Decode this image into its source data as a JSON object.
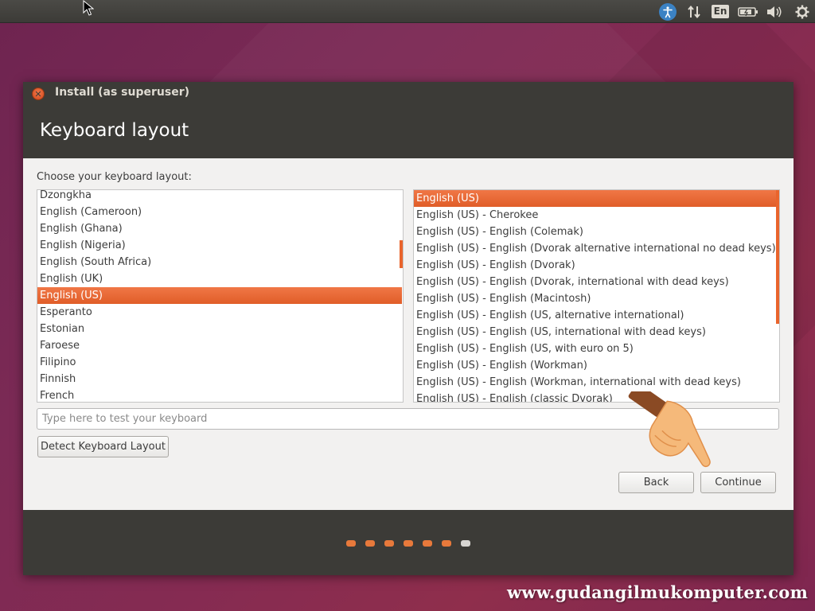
{
  "top_panel": {
    "language_indicator": "En",
    "icons": [
      "accessibility-icon",
      "network-icon",
      "language-indicator",
      "battery-icon",
      "volume-icon",
      "settings-gear-icon"
    ]
  },
  "window": {
    "title": "Install (as superuser)",
    "heading": "Keyboard layout"
  },
  "content": {
    "choose_label": "Choose your keyboard layout:",
    "layouts": [
      {
        "label": "Dzongkha",
        "selected": false
      },
      {
        "label": "English (Cameroon)",
        "selected": false
      },
      {
        "label": "English (Ghana)",
        "selected": false
      },
      {
        "label": "English (Nigeria)",
        "selected": false
      },
      {
        "label": "English (South Africa)",
        "selected": false
      },
      {
        "label": "English (UK)",
        "selected": false
      },
      {
        "label": "English (US)",
        "selected": true
      },
      {
        "label": "Esperanto",
        "selected": false
      },
      {
        "label": "Estonian",
        "selected": false
      },
      {
        "label": "Faroese",
        "selected": false
      },
      {
        "label": "Filipino",
        "selected": false
      },
      {
        "label": "Finnish",
        "selected": false
      },
      {
        "label": "French",
        "selected": false
      }
    ],
    "variants": [
      {
        "label": "English (US)",
        "selected": true
      },
      {
        "label": "English (US) - Cherokee",
        "selected": false
      },
      {
        "label": "English (US) - English (Colemak)",
        "selected": false
      },
      {
        "label": "English (US) - English (Dvorak alternative international no dead keys)",
        "selected": false
      },
      {
        "label": "English (US) - English (Dvorak)",
        "selected": false
      },
      {
        "label": "English (US) - English (Dvorak, international with dead keys)",
        "selected": false
      },
      {
        "label": "English (US) - English (Macintosh)",
        "selected": false
      },
      {
        "label": "English (US) - English (US, alternative international)",
        "selected": false
      },
      {
        "label": "English (US) - English (US, international with dead keys)",
        "selected": false
      },
      {
        "label": "English (US) - English (US, with euro on 5)",
        "selected": false
      },
      {
        "label": "English (US) - English (Workman)",
        "selected": false
      },
      {
        "label": "English (US) - English (Workman, international with dead keys)",
        "selected": false
      },
      {
        "label": "English (US) - English (classic Dvorak)",
        "selected": false
      }
    ],
    "test_input": {
      "value": "",
      "placeholder": "Type here to test your keyboard"
    },
    "detect_button": "Detect Keyboard Layout",
    "back_button": "Back",
    "continue_button": "Continue"
  },
  "progress": {
    "total_steps": 7,
    "current_step": 7
  },
  "watermark": "www.gudangilmukomputer.com",
  "colors": {
    "accent": "#E95420",
    "panel": "#3C3B37",
    "window_bg": "#F2F1F0"
  }
}
